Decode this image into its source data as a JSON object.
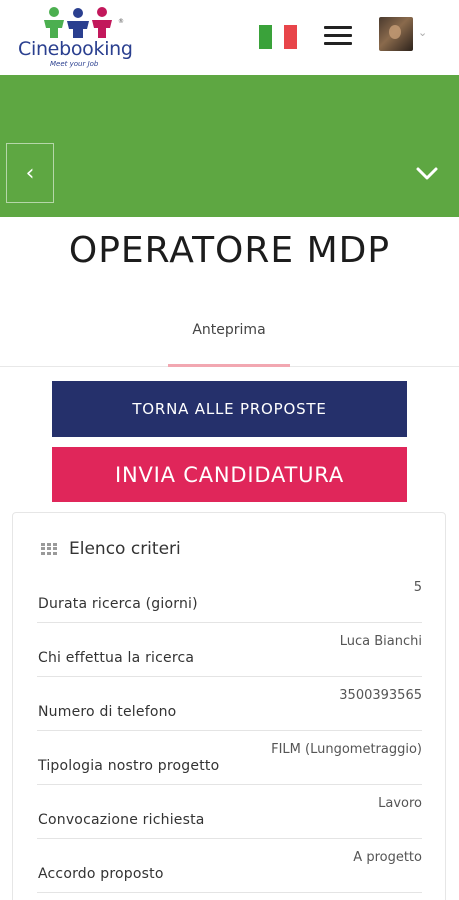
{
  "header": {
    "logo_text": "Cinebooking",
    "logo_tagline": "Meet your Job",
    "logo_reg": "®",
    "flag_colors": [
      "#3aa23a",
      "#ffffff",
      "#e8454a"
    ],
    "avatar_chevron": "⌄"
  },
  "banner": {
    "color": "#5ea742",
    "back_icon": "‹"
  },
  "job": {
    "title": "OPERATORE MDP"
  },
  "tabs": [
    {
      "label": "Anteprima",
      "active": true
    }
  ],
  "actions": {
    "back_label": "TORNA ALLE PROPOSTE",
    "apply_label": "INVIA CANDIDATURA"
  },
  "criteria": {
    "title": "Elenco criteri",
    "rows": [
      {
        "label": "Durata ricerca (giorni)",
        "value": "5"
      },
      {
        "label": "Chi effettua la ricerca",
        "value": "Luca Bianchi"
      },
      {
        "label": "Numero di telefono",
        "value": "3500393565"
      },
      {
        "label": "Tipologia nostro progetto",
        "value": "FILM (Lungometraggio)"
      },
      {
        "label": "Convocazione richiesta",
        "value": "Lavoro"
      },
      {
        "label": "Accordo proposto",
        "value": "A progetto"
      }
    ]
  }
}
